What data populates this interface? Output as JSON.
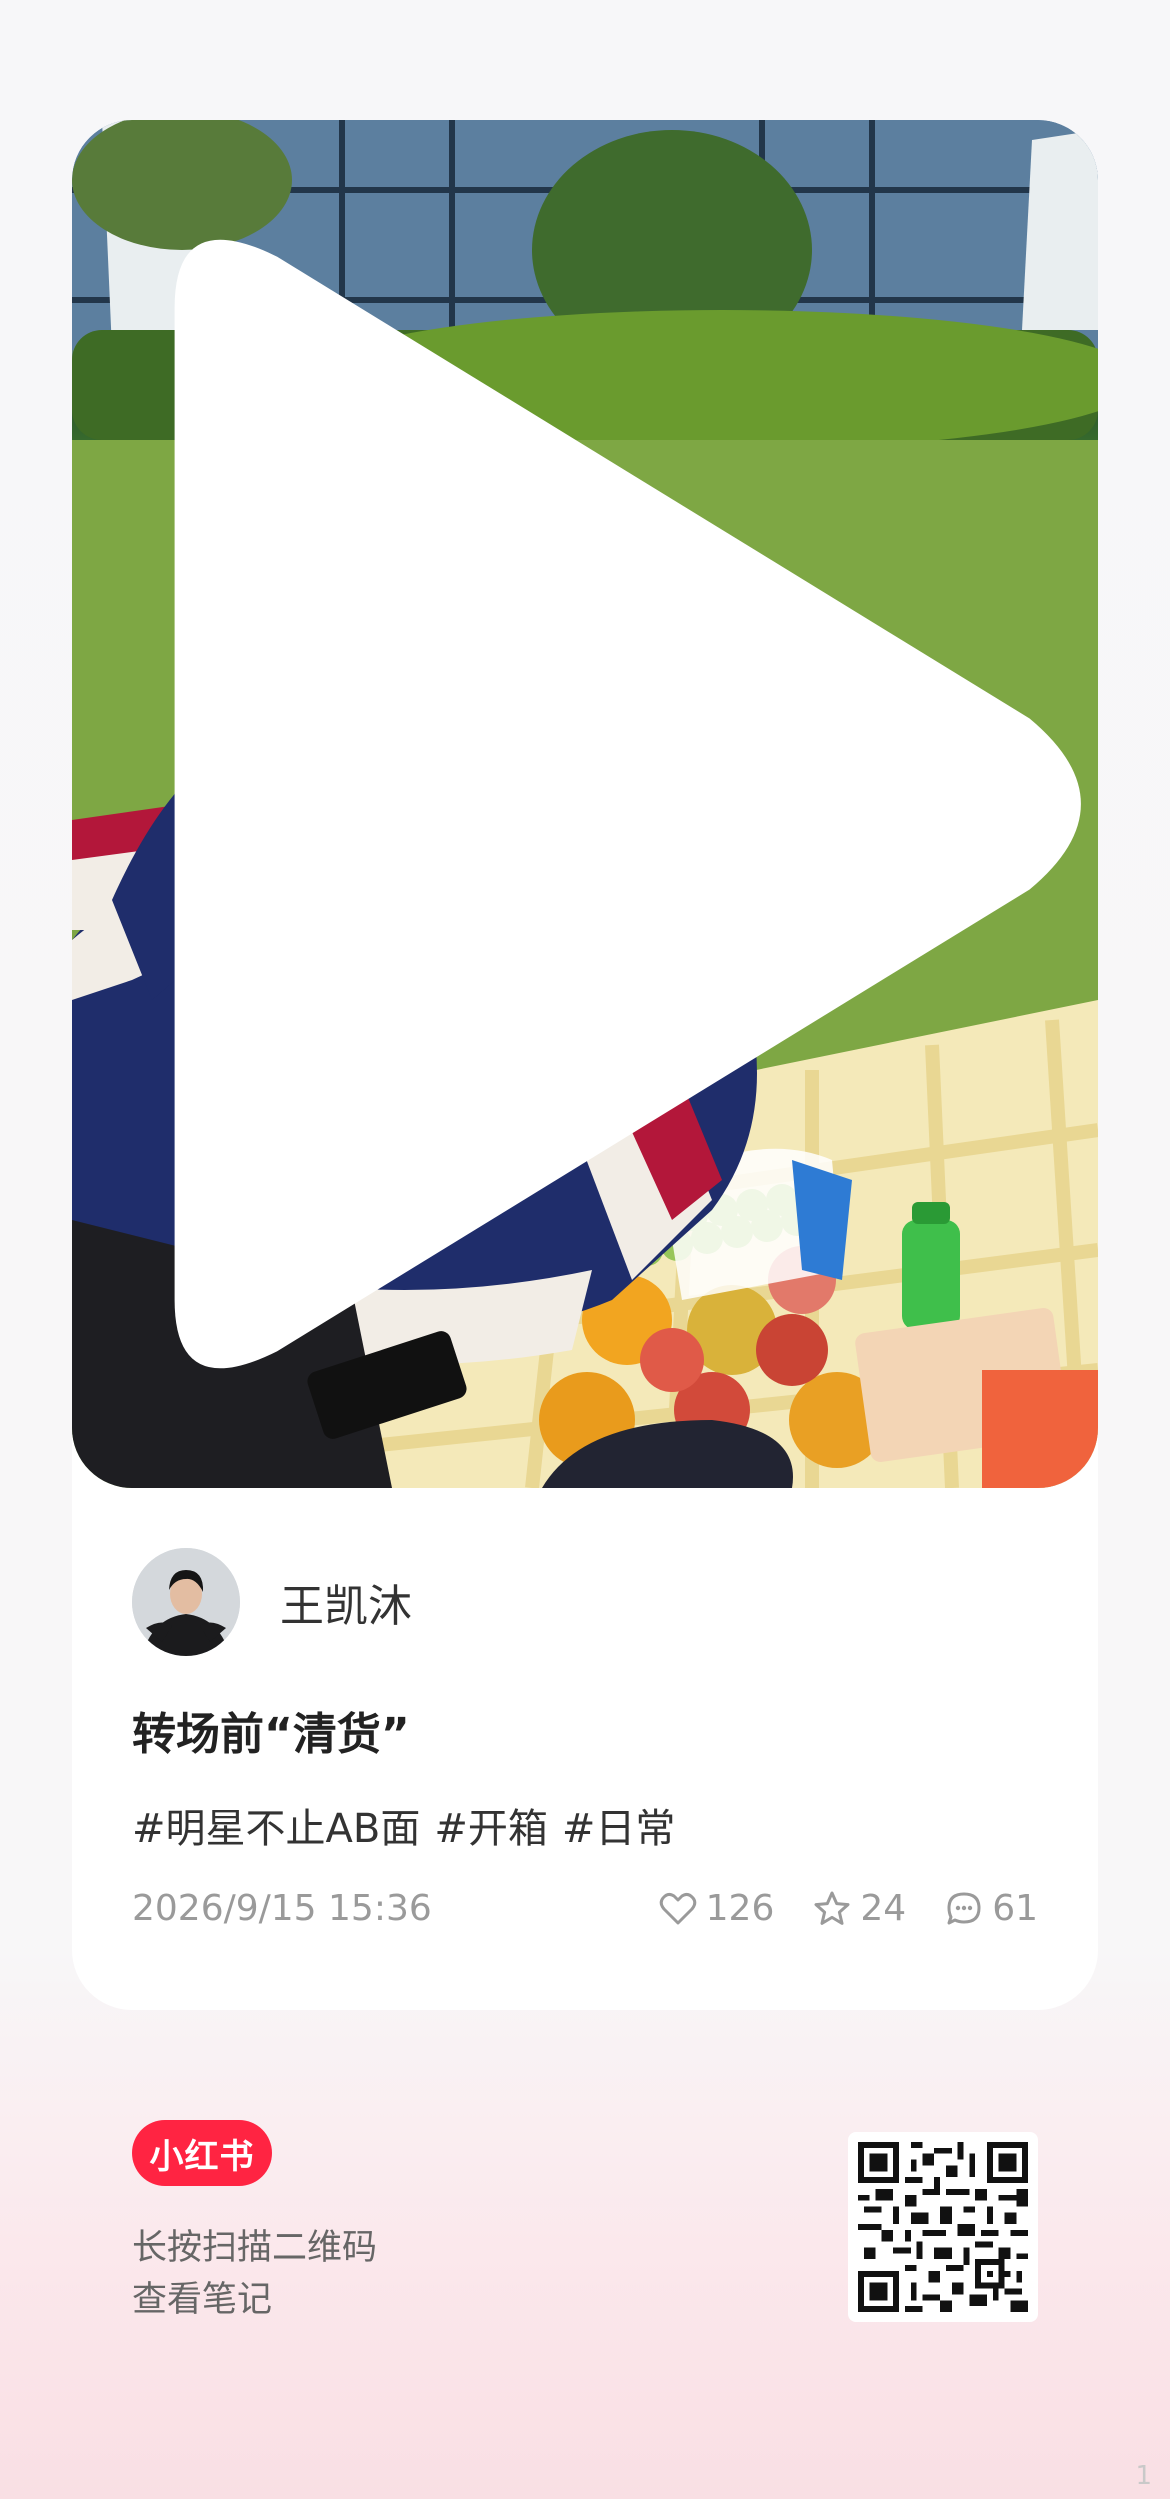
{
  "post": {
    "author_name": "王凯沐",
    "title": "转场前“清货”",
    "tags": [
      "#明星不止AB面",
      "#开箱",
      "#日常"
    ],
    "timestamp": "2026/9/15 15:36",
    "likes": "126",
    "collects": "24",
    "comments": "61",
    "media_type": "video"
  },
  "footer": {
    "brand_label": "小红书",
    "hint_line1": "长按扫描二维码",
    "hint_line2": "查看笔记",
    "page_indicator": "1"
  },
  "icons": {
    "play": "play-icon",
    "like": "heart-icon",
    "collect": "star-icon",
    "comment": "comment-icon",
    "qr": "qr-code-icon"
  },
  "colors": {
    "brand": "#ff2442",
    "meta_text": "#9a9a9a",
    "card_bg": "#ffffff"
  }
}
